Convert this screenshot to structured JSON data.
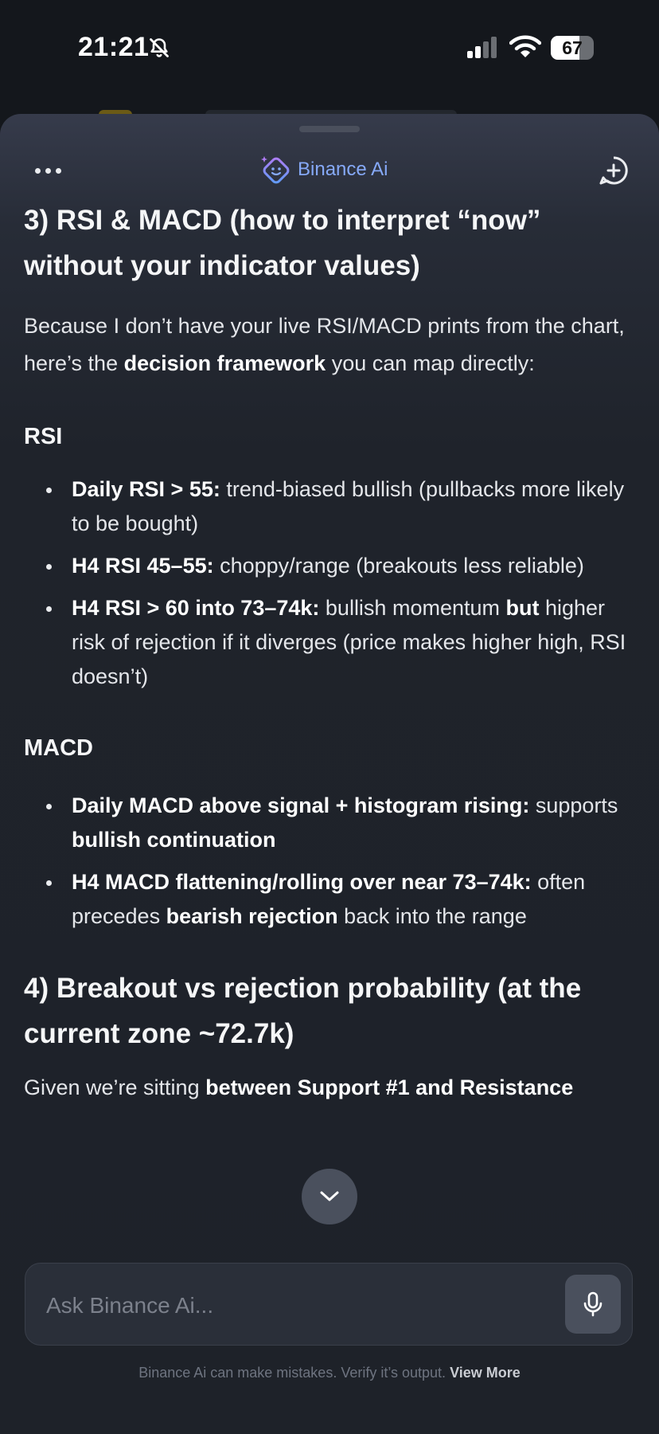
{
  "status_bar": {
    "time": "21:21",
    "battery_level": 67,
    "battery_text": "67"
  },
  "header": {
    "title": "Binance Ai",
    "brand_color": "#86a9f8"
  },
  "content": {
    "section3": {
      "heading": "3) RSI & MACD (how to interpret “now” without your indicator values)",
      "intro_part1": "Because I don’t have your live RSI/MACD prints from the chart, here’s the ",
      "intro_bold": "decision framework",
      "intro_part2": " you can map directly:"
    },
    "rsi": {
      "heading": "RSI",
      "items": [
        {
          "bold": "Daily RSI > 55:",
          "text": " trend‑biased bullish (pullbacks more likely to be bought)"
        },
        {
          "bold": "H4 RSI 45–55:",
          "text": " choppy/range (breakouts less reliable)"
        },
        {
          "bold": "H4 RSI > 60 into 73–74k:",
          "text": " bullish momentum ",
          "bold2": "but",
          "text2": " higher risk of rejection if it diverges (price makes higher high, RSI doesn’t)"
        }
      ]
    },
    "macd": {
      "heading": "MACD",
      "items": [
        {
          "bold": "Daily MACD above signal + histogram rising:",
          "text": " supports ",
          "bold2": "bullish continuation",
          "text2": ""
        },
        {
          "bold": "H4 MACD flattening/rolling over near 73–74k:",
          "text": " often precedes ",
          "bold2": "bearish rejection",
          "text2": " back into the range"
        }
      ]
    },
    "section4": {
      "heading": "4) Breakout vs rejection probability (at the current zone ~72.7k)",
      "text_part1": "Given we’re sitting ",
      "text_bold": "between Support #1 and Resistance"
    }
  },
  "input": {
    "placeholder": "Ask Binance Ai..."
  },
  "footer": {
    "disclaimer": "Binance Ai can make mistakes. Verify it’s output.",
    "view_more": "View More"
  },
  "icons": {
    "more": "more-horizontal-icon",
    "logo": "binance-ai-logo-icon",
    "new_chat": "plus-circle-icon",
    "scroll_down": "chevron-down-icon",
    "mic": "microphone-icon"
  }
}
